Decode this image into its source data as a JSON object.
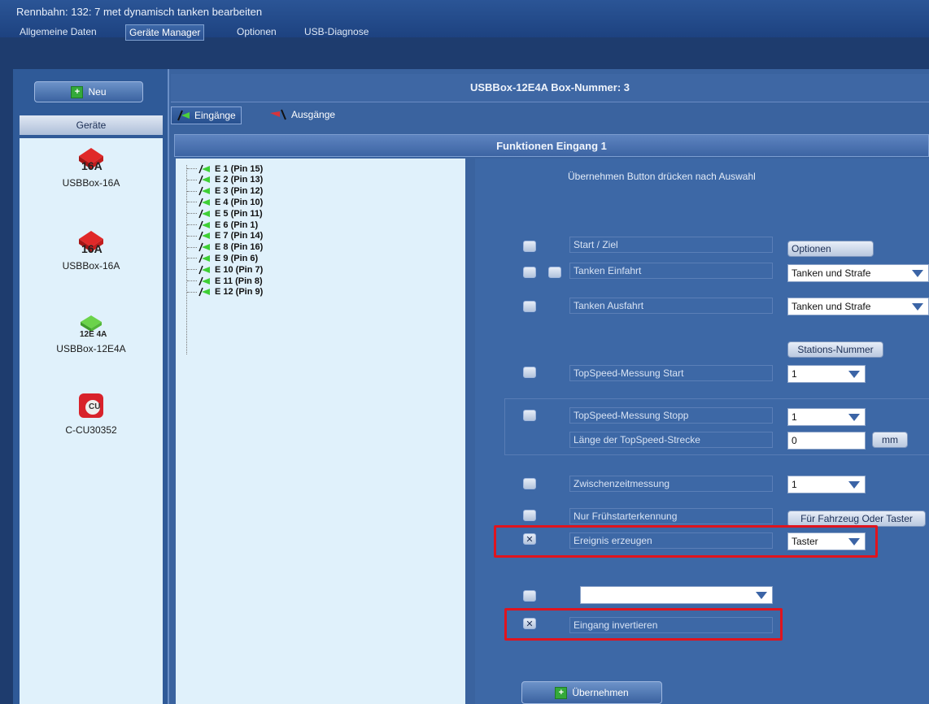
{
  "window": {
    "title": "Rennbahn: 132: 7 met dynamisch tanken bearbeiten"
  },
  "menu": [
    "Allgemeine Daten",
    "Geräte Manager",
    "Optionen",
    "USB-Diagnose"
  ],
  "left": {
    "new_label": "Neu",
    "header": "Geräte",
    "devices": [
      {
        "name": "USBBox-16A",
        "badge": "16A"
      },
      {
        "name": "USBBox-16A",
        "badge": "16A"
      },
      {
        "name": "USBBox-12E4A",
        "badge": "12E 4A"
      },
      {
        "name": "C-CU30352",
        "badge": "CU"
      }
    ]
  },
  "box": {
    "title": "USBBox-12E4A  Box-Nummer: 3"
  },
  "tabs": {
    "inputs": "Eingänge",
    "outputs": "Ausgänge"
  },
  "func": {
    "header": "Funktionen Eingang 1",
    "hint": "Übernehmen Button drücken nach Auswahl"
  },
  "inputs": [
    "E 1 (Pin 15)",
    "E 2 (Pin 13)",
    "E 3 (Pin 12)",
    "E 4 (Pin 10)",
    "E 5 (Pin 11)",
    "E 6 (Pin 1)",
    "E 7 (Pin 14)",
    "E 8 (Pin 16)",
    "E 9 (Pin 6)",
    "E 10 (Pin 7)",
    "E 11 (Pin 8)",
    "E 12 (Pin 9)"
  ],
  "rows": {
    "start": {
      "label": "Start / Ziel",
      "button": "Optionen"
    },
    "tank_in": {
      "label": "Tanken Einfahrt",
      "value": "Tanken und Strafe"
    },
    "tank_out": {
      "label": "Tanken Ausfahrt",
      "value": "Tanken und Strafe"
    },
    "stations_button": "Stations-Nummer",
    "ts_start": {
      "label": "TopSpeed-Messung Start",
      "value": "1"
    },
    "ts_stop": {
      "label": "TopSpeed-Messung Stopp",
      "value": "1"
    },
    "ts_len": {
      "label": "Länge der TopSpeed-Strecke",
      "value": "0",
      "unit": "mm"
    },
    "split": {
      "label": "Zwischenzeitmessung",
      "value": "1"
    },
    "early": {
      "label": "Nur Frühstarterkennung",
      "button": "Für Fahrzeug Oder Taster"
    },
    "event": {
      "label": "Ereignis erzeugen",
      "value": "Taster",
      "check": "✕"
    },
    "invert": {
      "label": "Eingang invertieren",
      "check": "✕"
    }
  },
  "apply_label": "Übernehmen",
  "colors": {
    "accent_red": "#e0141e",
    "panel_blue": "#3d68a6",
    "list_bg": "#e0f1fb"
  }
}
